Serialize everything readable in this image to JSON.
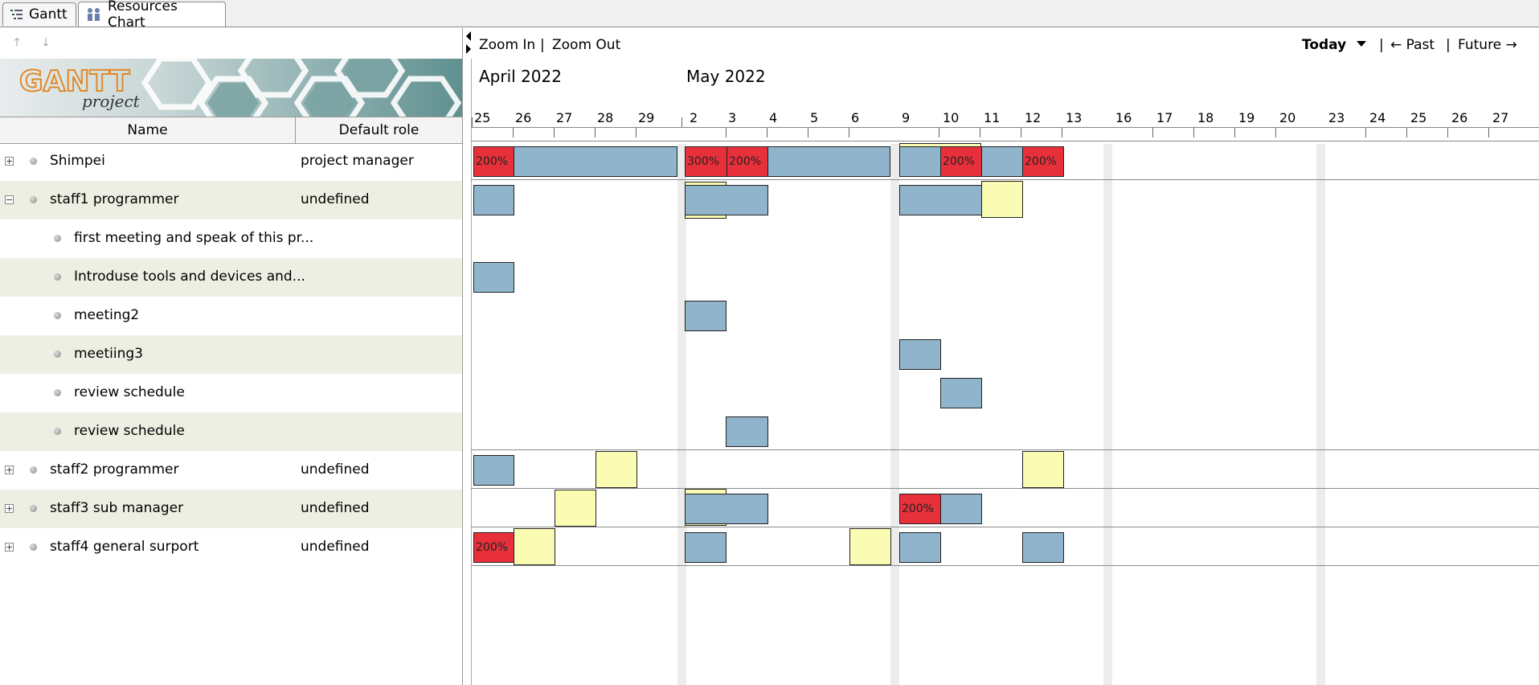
{
  "tabs": [
    {
      "label": "Gantt",
      "icon": "gantt-icon"
    },
    {
      "label": "Resources Chart",
      "icon": "resources-icon"
    }
  ],
  "left": {
    "move_up_icon": "arrow-up-icon",
    "move_down_icon": "arrow-down-icon",
    "logo": {
      "text": "GANTT",
      "subtext": "project"
    },
    "columns": {
      "name": "Name",
      "role": "Default role"
    },
    "rows": [
      {
        "name": "Shimpei",
        "role": "project manager",
        "expander": "+",
        "level": 0
      },
      {
        "name": "staff1 programmer",
        "role": "undefined",
        "expander": "−",
        "level": 0
      },
      {
        "name": "first meeting and speak of this pr...",
        "role": "",
        "expander": "",
        "level": 1
      },
      {
        "name": "Introduse tools and devices and...",
        "role": "",
        "expander": "",
        "level": 1
      },
      {
        "name": "meeting2",
        "role": "",
        "expander": "",
        "level": 1
      },
      {
        "name": "meetiing3",
        "role": "",
        "expander": "",
        "level": 1
      },
      {
        "name": "review schedule",
        "role": "",
        "expander": "",
        "level": 1
      },
      {
        "name": "review schedule",
        "role": "",
        "expander": "",
        "level": 1
      },
      {
        "name": "staff2 programmer",
        "role": "undefined",
        "expander": "+",
        "level": 0
      },
      {
        "name": "staff3 sub manager",
        "role": "undefined",
        "expander": "+",
        "level": 0
      },
      {
        "name": "staff4 general surport",
        "role": "undefined",
        "expander": "+",
        "level": 0
      }
    ]
  },
  "chart": {
    "toolbar": {
      "zoom_in": "Zoom In",
      "sep1": "|",
      "zoom_out": "Zoom Out",
      "today": "Today",
      "sep2": "|",
      "past": "← Past",
      "sep3": "|",
      "future": "Future →"
    },
    "months": [
      "April 2022",
      "May 2022"
    ],
    "days": [
      "25",
      "26",
      "27",
      "28",
      "29",
      "2",
      "3",
      "4",
      "5",
      "6",
      "9",
      "10",
      "11",
      "12",
      "13",
      "16",
      "17",
      "18",
      "19",
      "20",
      "23",
      "24",
      "25",
      "26",
      "27"
    ],
    "load_labels": {
      "l200": "200%",
      "l300": "300%"
    },
    "colors": {
      "normal": "#8fb4cc",
      "overload": "#e8303a",
      "underload": "#fbfcb4",
      "alt_row": "#eeefe3"
    }
  }
}
